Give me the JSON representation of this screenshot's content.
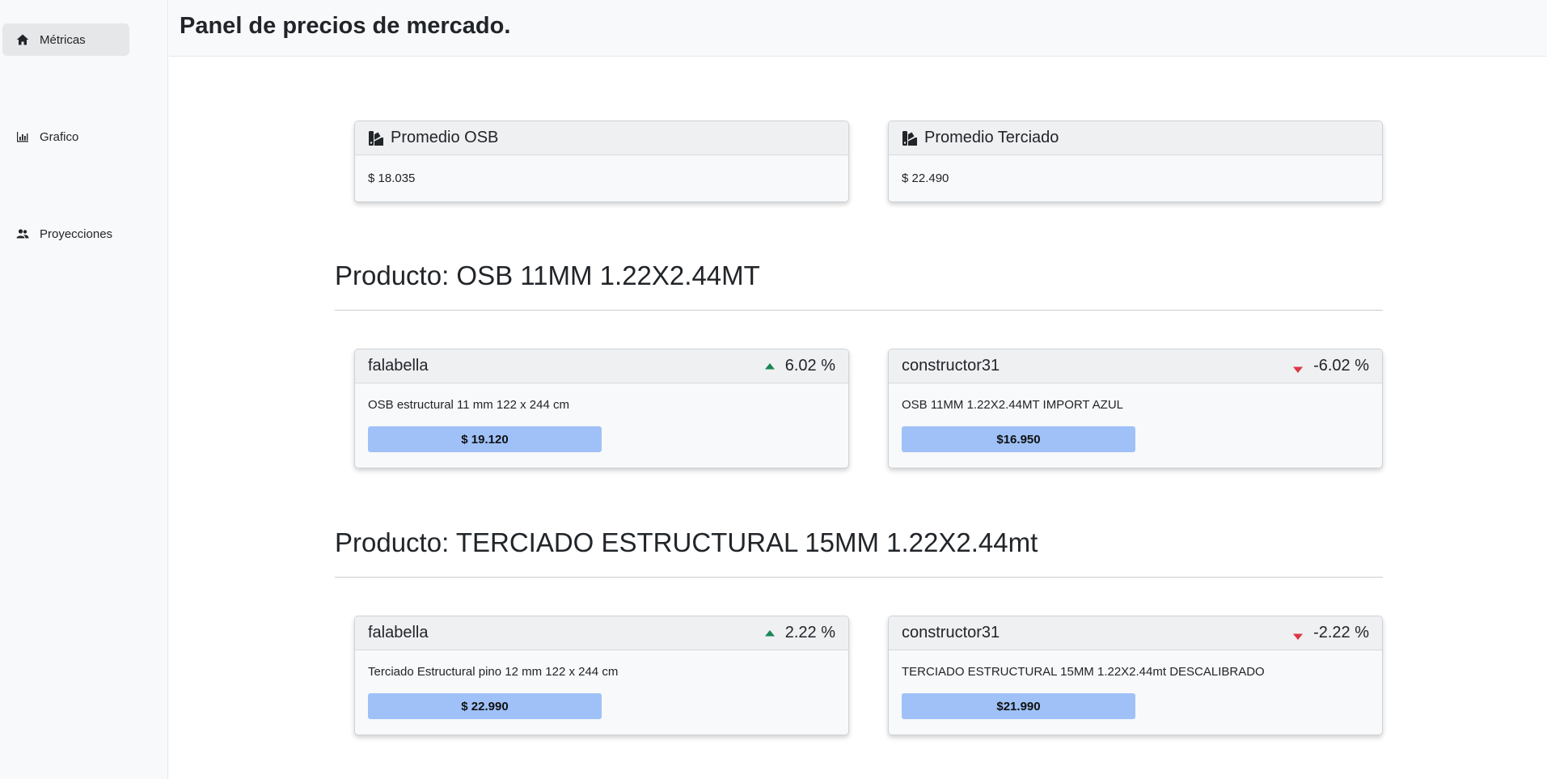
{
  "sidebar": {
    "items": [
      {
        "label": "Métricas",
        "icon": "home-icon",
        "active": true
      },
      {
        "label": "Grafico",
        "icon": "bar-chart-icon",
        "active": false
      },
      {
        "label": "Proyecciones",
        "icon": "users-icon",
        "active": false
      }
    ]
  },
  "header": {
    "title": "Panel de precios de mercado."
  },
  "summary": [
    {
      "title": "Promedio OSB",
      "icon": "swatches-icon",
      "value": "$ 18.035"
    },
    {
      "title": "Promedio Terciado",
      "icon": "swatches-icon",
      "value": "$ 22.490"
    }
  ],
  "products": [
    {
      "title": "Producto: OSB 11MM 1.22X2.44MT",
      "offers": [
        {
          "store": "falabella",
          "change": "6.02 %",
          "direction": "up",
          "description": "OSB estructural 11 mm 122 x 244 cm",
          "price": "$ 19.120"
        },
        {
          "store": "constructor31",
          "change": "-6.02 %",
          "direction": "down",
          "description": "OSB 11MM 1.22X2.44MT IMPORT AZUL",
          "price": "$16.950"
        }
      ]
    },
    {
      "title": "Producto: TERCIADO ESTRUCTURAL 15MM 1.22X2.44mt",
      "offers": [
        {
          "store": "falabella",
          "change": "2.22 %",
          "direction": "up",
          "description": "Terciado Estructural pino 12 mm 122 x 244 cm",
          "price": "$ 22.990"
        },
        {
          "store": "constructor31",
          "change": "-2.22 %",
          "direction": "down",
          "description": "TERCIADO ESTRUCTURAL 15MM 1.22X2.44mt DESCALIBRADO",
          "price": "$21.990"
        }
      ]
    }
  ],
  "colors": {
    "up": "#198754",
    "down": "#dc3545",
    "price_pill": "#9fc1f8",
    "sidebar_active": "#e6e7e9"
  }
}
